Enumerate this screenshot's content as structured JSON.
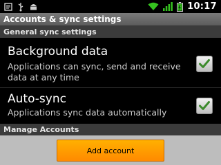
{
  "status_bar": {
    "time": "10:17",
    "left_icons": [
      "notification-icon",
      "usb-icon",
      "android-debug-icon"
    ],
    "right_icons": [
      "wifi-icon",
      "signal-icon",
      "battery-icon"
    ]
  },
  "title_bar": {
    "title": "Accounts & sync settings"
  },
  "sections": {
    "general": "General sync settings",
    "manage": "Manage Accounts"
  },
  "preferences": {
    "background_data": {
      "title": "Background data",
      "summary": "Applications can sync, send and receive data at any time",
      "checked": true
    },
    "auto_sync": {
      "title": "Auto-sync",
      "summary": "Applications sync data automatically",
      "checked": true
    }
  },
  "bottom": {
    "add_account_label": "Add account"
  },
  "colors": {
    "accent_button": "#ffa000",
    "check_green": "#3c8a2c"
  }
}
